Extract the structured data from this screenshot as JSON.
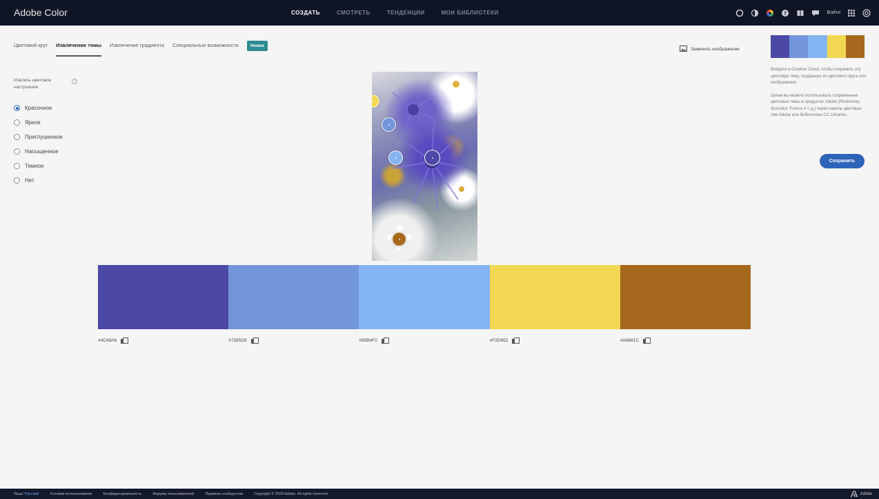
{
  "app": {
    "title": "Adobe Color"
  },
  "nav": {
    "items": [
      "СОЗДАТЬ",
      "СМОТРЕТЬ",
      "ТЕНДЕНЦИИ",
      "МОИ БИБЛИОТЕКИ"
    ],
    "active": "СОЗДАТЬ",
    "signin": "Войти"
  },
  "tabs": {
    "items": [
      "Цветовой круг",
      "Извлечение темы",
      "Извлечение градиента",
      "Специальные возможности"
    ],
    "active": "Извлечение темы",
    "badge": "Новое"
  },
  "replace_image": "Заменить изображение",
  "mood": {
    "label": "Извлечь цветовое настроение",
    "options": [
      "Красочное",
      "Яркое",
      "Приглушенное",
      "Насыщенное",
      "Темное",
      "Нет"
    ],
    "selected": "Красочное"
  },
  "palette": {
    "colors": [
      "#4C49A6",
      "#7395D9",
      "#85B4F2",
      "#F2D852",
      "#A6681C"
    ],
    "hex_labels": [
      "#4C49A6",
      "#7395D9",
      "#85B4F2",
      "#F2D852",
      "#A6681C"
    ]
  },
  "info": {
    "para1": "Войдите в Creative Cloud, чтобы сохранить эту цветовую тему, созданную из цветового круга или изображения.",
    "para2": "Затем вы можете использовать сохраненные цветовые темы в продуктах Adobe (Photoshop, Illustrator, Fresco и т. д.) через панель цветовых тем Adobe или библиотеки CC Libraries.",
    "save_label": "Сохранить"
  },
  "footer": {
    "lang_label": "Язык:",
    "lang_value": "Русский",
    "links": [
      "Условия использования",
      "Конфиденциальность",
      "Форумы пользователей",
      "Правила сообщества"
    ],
    "copyright": "Copyright © 2020 Adobe. All rights reserved.",
    "adobe": "Adobe"
  }
}
